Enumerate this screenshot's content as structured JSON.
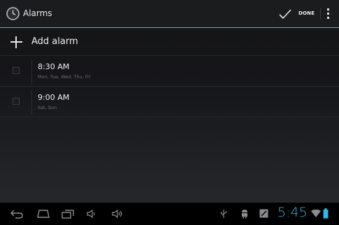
{
  "action_bar": {
    "title": "Alarms",
    "done_label": "DONE",
    "accent_color": "#33b5e5"
  },
  "add_alarm": {
    "label": "Add alarm"
  },
  "alarms": [
    {
      "time": "8:30 AM",
      "days": "Mon, Tue, Wed, Thu, Fri",
      "enabled": false
    },
    {
      "time": "9:00 AM",
      "days": "Sat, Sun",
      "enabled": false
    }
  ],
  "status": {
    "clock": "5:45"
  },
  "icons": {
    "app": "alarm-clock-icon",
    "done": "checkmark-icon",
    "overflow": "overflow-menu-icon",
    "add": "plus-icon",
    "nav": [
      "back-icon",
      "home-icon",
      "recent-apps-icon",
      "volume-down-icon",
      "volume-up-icon"
    ],
    "status": [
      "usb-icon",
      "android-debug-icon",
      "notification-icon",
      "wifi-icon",
      "battery-icon"
    ]
  }
}
